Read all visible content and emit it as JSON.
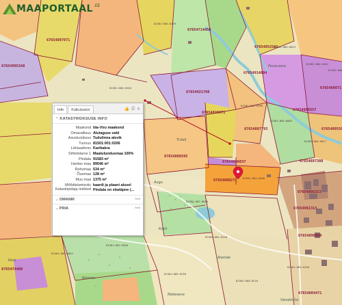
{
  "app": {
    "logo_text": "MAAPORTAAL",
    "logo_suffix": ".EE"
  },
  "panel": {
    "tabs": [
      {
        "label": "Info",
        "active": true
      },
      {
        "label": "Kalkulaator",
        "active": false
      }
    ],
    "icons": [
      "thumbs-icon",
      "print-icon",
      "close-icon"
    ],
    "section_title": "KATASTRIÜKSUSE INFO",
    "rows": [
      {
        "key": "Maakond",
        "value": "Ida-Viru maakond"
      },
      {
        "key": "Omavalitsus",
        "value": "Alutaguse vald"
      },
      {
        "key": "Asustusüksus",
        "value": "Tudulinna alevik"
      },
      {
        "key": "Tunnus",
        "value": "81501:001:0206"
      },
      {
        "key": "Lähiaadress",
        "value": "Karikakra"
      },
      {
        "key": "Sihtotstarve 1",
        "value": "Maatulundusmaa 100%"
      },
      {
        "key": "Pindala",
        "value": "91583 m²"
      },
      {
        "key": "Haritav maa",
        "value": "89546 m²"
      },
      {
        "key": "Rohumaa",
        "value": "534 m²"
      },
      {
        "key": "Õuemaa",
        "value": "128 m²"
      },
      {
        "key": "Muu maa",
        "value": "1375 m²"
      },
      {
        "key": "Mõõdistamisviis",
        "value": "kaardi ja plaani alusel"
      },
      {
        "key": "Katastripidaja märked",
        "value": "Pindala on ebatäpne (..."
      }
    ],
    "sections": [
      {
        "label": "OMANIK",
        "action": "Ava"
      },
      {
        "label": "PRIA",
        "action": "Ava"
      }
    ]
  },
  "map": {
    "parcel_ids": [
      "67654714458",
      "67654921708",
      "67654914004",
      "67654829971",
      "67654808837",
      "67654889557",
      "67654887793",
      "67654806595",
      "67654808271",
      "67654897308",
      "6765489558",
      "67654897071",
      "67654995348",
      "67654961313",
      "67654866313",
      "67654898009",
      "67654884471",
      "67654852561",
      "6765474408",
      "6765489871"
    ],
    "cadastral_codes": [
      "81501:004:0159",
      "81501:004:0013",
      "81501:004:0160",
      "81501:004:0161",
      "81501:004:0012",
      "81501:004:0164",
      "81501:002:0051",
      "81501:004:0017",
      "81501:004:0083",
      "81501:001:0206",
      "81501:001:0016",
      "81501:001:0210",
      "81501:002:0206",
      "81501:005:0150",
      "81501:005:0210",
      "81501:003:0150"
    ],
    "place_names": [
      "Pesavaaro",
      "Tirteli",
      "Augu",
      "Kopli",
      "Nõmme",
      "Aiamäe",
      "Vanakõrtsi",
      "Nebeseva",
      "Kesk"
    ],
    "colors": {
      "arable": "#f4b67d",
      "grassland": "#e6d55e",
      "forest_lilac": "#c88ed6",
      "forest_green": "#a8d98a",
      "water": "#8ecbd8",
      "boundary": "#8a1533",
      "selected": "#f4a23a",
      "marker": "#e0193a"
    }
  }
}
